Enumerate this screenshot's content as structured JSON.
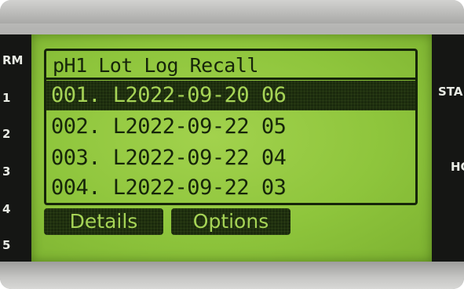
{
  "left_keys": [
    "RM",
    "1",
    "2",
    "3",
    "4",
    "5"
  ],
  "right_keys": [
    "STA",
    "HC"
  ],
  "screen": {
    "title": "pH1  Lot Log Recall",
    "entries": [
      "001. L2022-09-20 06",
      "002. L2022-09-22 05",
      "003. L2022-09-22 04",
      "004. L2022-09-22 03"
    ],
    "selected_index": 0,
    "softkeys": {
      "details": "Details",
      "options": "Options"
    }
  },
  "colors": {
    "lcd_background": "#8ec53c",
    "lcd_ink": "#16250a",
    "bezel": "#151614"
  }
}
